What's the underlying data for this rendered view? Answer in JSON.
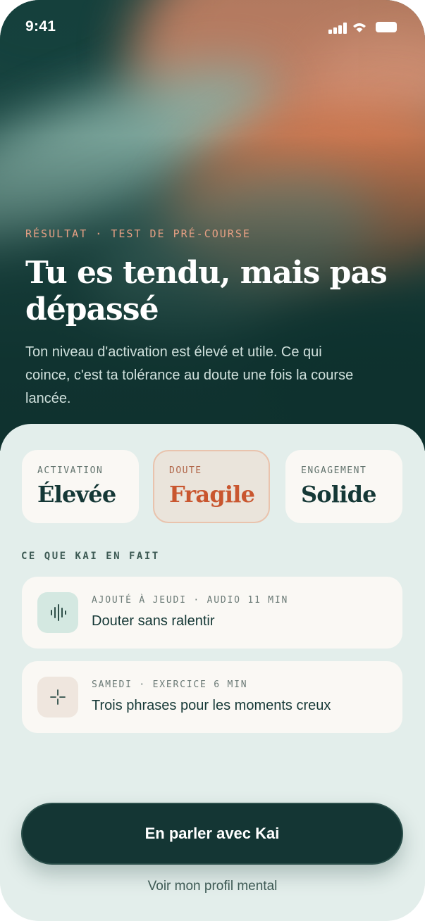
{
  "status_bar": {
    "time": "9:41"
  },
  "hero": {
    "eyebrow": "RÉSULTAT · TEST DE PRÉ-COURSE",
    "title": "Tu es tendu, mais pas dépassé",
    "subtitle": "Ton niveau d'activation est élevé et utile. Ce qui coince, c'est ta tolérance au doute une fois la course lancée."
  },
  "metrics": [
    {
      "label": "ACTIVATION",
      "value": "Élevée"
    },
    {
      "label": "DOUTE",
      "value": "Fragile",
      "highlight_color": "#c9562f"
    },
    {
      "label": "ENGAGEMENT",
      "value": "Solide"
    }
  ],
  "section": {
    "label": "CE QUE KAI EN FAIT"
  },
  "actions": [
    {
      "meta": "AJOUTÉ À JEUDI · AUDIO 11 MIN",
      "title": "Douter sans ralentir",
      "icon": "audio-wave-icon"
    },
    {
      "meta": "SAMEDI · EXERCICE 6 MIN",
      "title": "Trois phrases pour les moments creux",
      "icon": "sparkle-icon"
    }
  ],
  "cta": {
    "primary_label": "En parler avec Kai",
    "secondary_label": "Voir mon profil mental"
  },
  "colors": {
    "dark_teal": "#143634",
    "accent_orange": "#c9562f",
    "eyebrow_peach": "#e7a084",
    "sheet_bg": "#e3eeeb",
    "card_bg": "#faf8f4"
  }
}
